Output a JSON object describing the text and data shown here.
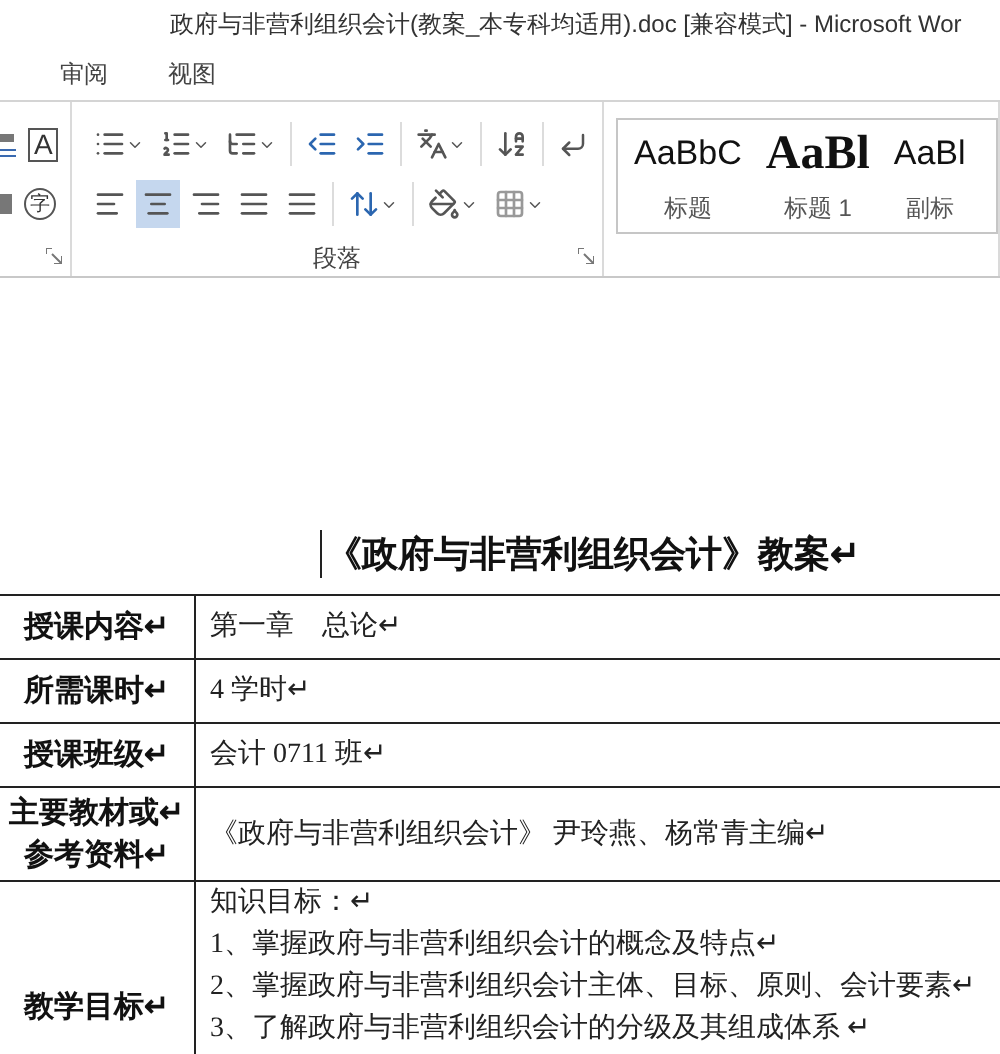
{
  "title_bar": {
    "title": "政府与非营利组织会计(教案_本专科均适用).doc [兼容模式] - Microsoft Wor"
  },
  "ribbon_tabs": [
    {
      "label": "审阅",
      "selected": false
    },
    {
      "label": "视图",
      "selected": false
    }
  ],
  "font_group": {
    "border_char": "A",
    "enclosed_char": "字"
  },
  "paragraph_group": {
    "label": "段落",
    "align_buttons": [
      {
        "kind": "left",
        "selected": false
      },
      {
        "kind": "center",
        "selected": true
      },
      {
        "kind": "right",
        "selected": false
      },
      {
        "kind": "justify",
        "selected": false
      },
      {
        "kind": "distributed",
        "selected": false
      }
    ]
  },
  "styles": [
    {
      "kind": "sans",
      "preview": "AaBbC",
      "name": "标题"
    },
    {
      "kind": "serif",
      "preview": "AaBl",
      "name": "标题 1"
    },
    {
      "kind": "sans",
      "preview": "AaBl",
      "name": "副标"
    }
  ],
  "document": {
    "title": "《政府与非营利组织会计》教案↵",
    "rows": [
      {
        "label_lines": [
          "授课内容↵"
        ],
        "lines": [
          "第一章　总论↵"
        ]
      },
      {
        "label_lines": [
          "所需课时↵"
        ],
        "lines": [
          "4 学时↵"
        ]
      },
      {
        "label_lines": [
          "授课班级↵"
        ],
        "lines": [
          "会计 0711 班↵"
        ]
      },
      {
        "label_lines": [
          "主要教材或↵",
          "参考资料↵"
        ],
        "lines": [
          "《政府与非营利组织会计》 尹玲燕、杨常青主编↵"
        ]
      },
      {
        "label_lines": [
          "教学目标↵"
        ],
        "lines": [
          "知识目标：↵",
          "1、掌握政府与非营利组织会计的概念及特点↵",
          "2、掌握政府与非营利组织会计主体、目标、原则、会计要素↵",
          "3、了解政府与非营利组织会计的分级及其组成体系 ↵"
        ]
      }
    ]
  }
}
